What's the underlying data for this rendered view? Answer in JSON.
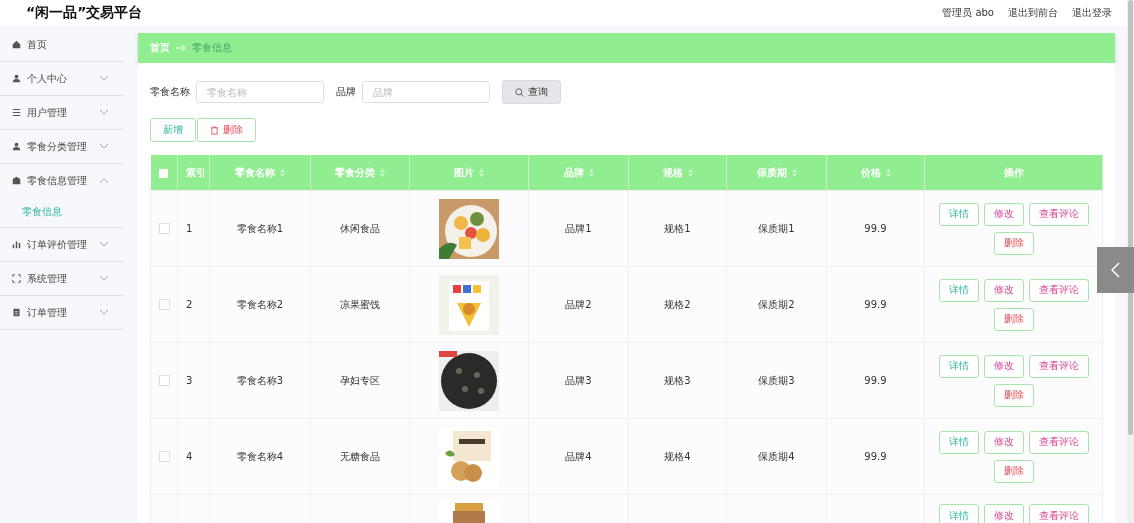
{
  "header": {
    "title": "“闲一品”交易平台",
    "links": [
      "管理员 abo",
      "退出到前台",
      "退出登录"
    ]
  },
  "sidebar": {
    "items": [
      {
        "label": "首页",
        "kind": "link"
      },
      {
        "label": "个人中心",
        "kind": "menu",
        "expanded": false
      },
      {
        "label": "用户管理",
        "kind": "menu",
        "expanded": false
      },
      {
        "label": "零食分类管理",
        "kind": "menu",
        "expanded": false
      },
      {
        "label": "零食信息管理",
        "kind": "menu",
        "expanded": true,
        "children": [
          {
            "label": "零食信息",
            "selected": true
          }
        ]
      },
      {
        "label": "订单评价管理",
        "kind": "menu",
        "expanded": false
      },
      {
        "label": "系统管理",
        "kind": "menu",
        "expanded": false
      },
      {
        "label": "订单管理",
        "kind": "menu",
        "expanded": false
      }
    ]
  },
  "breadcrumb": [
    "首页",
    "零食信息"
  ],
  "search": {
    "fields": [
      {
        "label": "零食名称",
        "placeholder": "零食名称"
      },
      {
        "label": "品牌",
        "placeholder": "品牌"
      }
    ],
    "button": "查询"
  },
  "actions": [
    {
      "label": "新增",
      "kind": "add"
    },
    {
      "label": "删除",
      "kind": "delete"
    }
  ],
  "table": {
    "select_all": {
      "checked": false
    },
    "columns": [
      {
        "label": "索引",
        "sortable": false
      },
      {
        "label": "零食名称",
        "sortable": true
      },
      {
        "label": "零食分类",
        "sortable": true
      },
      {
        "label": "图片",
        "sortable": true
      },
      {
        "label": "品牌",
        "sortable": true
      },
      {
        "label": "规格",
        "sortable": true
      },
      {
        "label": "保质期",
        "sortable": true
      },
      {
        "label": "价格",
        "sortable": true
      },
      {
        "label": "操作",
        "sortable": false
      }
    ],
    "rows": [
      {
        "checked": false,
        "cells": [
          "1",
          "零食名称1",
          "休闲食品",
          "品牌1",
          "规格1",
          "保质期1",
          "99.9"
        ],
        "image": {
          "kind": "picture"
        },
        "actions": [
          "详情",
          "修改",
          "查看评论",
          "删除"
        ]
      },
      {
        "checked": false,
        "cells": [
          "2",
          "零食名称2",
          "凉果蜜饯",
          "品牌2",
          "规格2",
          "保质期2",
          "99.9"
        ],
        "image": {
          "kind": "picture"
        },
        "actions": [
          "详情",
          "修改",
          "查看评论",
          "删除"
        ]
      },
      {
        "checked": false,
        "cells": [
          "3",
          "零食名称3",
          "孕妇专区",
          "品牌3",
          "规格3",
          "保质期3",
          "99.9"
        ],
        "image": {
          "kind": "picture"
        },
        "actions": [
          "详情",
          "修改",
          "查看评论",
          "删除"
        ]
      },
      {
        "checked": false,
        "cells": [
          "4",
          "零食名称4",
          "无糖食品",
          "品牌4",
          "规格4",
          "保质期4",
          "99.9"
        ],
        "image": {
          "kind": "picture"
        },
        "actions": [
          "详情",
          "修改",
          "查看评论",
          "删除"
        ]
      },
      {
        "image": {
          "kind": "picture"
        },
        "actions": [
          "详情",
          "修改",
          "查看评论"
        ]
      }
    ]
  }
}
